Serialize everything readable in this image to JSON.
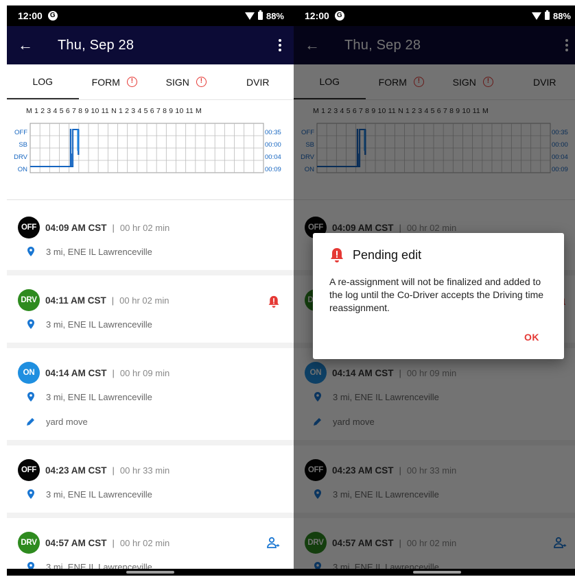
{
  "status": {
    "time": "12:00",
    "notification_icon": "G",
    "battery": "88%"
  },
  "appbar": {
    "title": "Thu, Sep 28"
  },
  "tabs": [
    {
      "label": "LOG",
      "warning": false,
      "active": true
    },
    {
      "label": "FORM",
      "warning": true,
      "active": false
    },
    {
      "label": "SIGN",
      "warning": true,
      "active": false
    },
    {
      "label": "DVIR",
      "warning": false,
      "active": false
    }
  ],
  "graph": {
    "hour_labels": "M 1 2 3 4 5 6 7 8 9 10 11 N 1 2 3 4 5 6 7 8 9 10 11 M",
    "rows": [
      {
        "label": "OFF",
        "total": "00:35"
      },
      {
        "label": "SB",
        "total": "00:00"
      },
      {
        "label": "DRV",
        "total": "00:04"
      },
      {
        "label": "ON",
        "total": "00:09"
      }
    ]
  },
  "events": [
    {
      "status": "OFF",
      "time": "04:09 AM CST",
      "duration": "00 hr 02 min",
      "location": "3 mi, ENE IL Lawrenceville",
      "note": "",
      "icon": ""
    },
    {
      "status": "DRV",
      "time": "04:11 AM CST",
      "duration": "00 hr 02 min",
      "location": "3 mi, ENE IL Lawrenceville",
      "note": "",
      "icon": "bell-icon"
    },
    {
      "status": "ON",
      "time": "04:14 AM CST",
      "duration": "00 hr 09 min",
      "location": "3 mi, ENE IL Lawrenceville",
      "note": "yard move",
      "icon": ""
    },
    {
      "status": "OFF",
      "time": "04:23 AM CST",
      "duration": "00 hr 33 min",
      "location": "3 mi, ENE IL Lawrenceville",
      "note": "",
      "icon": ""
    },
    {
      "status": "DRV",
      "time": "04:57 AM CST",
      "duration": "00 hr 02 min",
      "location": "3 mi, ENE IL Lawrenceville",
      "note": "",
      "icon": "assign-driver-icon"
    }
  ],
  "dialog": {
    "title": "Pending edit",
    "message": "A re-assignment will not be finalized and added to the log until the Co-Driver accepts the Driving time reassignment.",
    "ok_label": "OK"
  },
  "colors": {
    "appbar": "#0c0b36",
    "off": "#050505",
    "drv": "#2e8b1f",
    "on": "#1f8fe0",
    "accent": "#e53935",
    "graph_line": "#1565c0"
  }
}
